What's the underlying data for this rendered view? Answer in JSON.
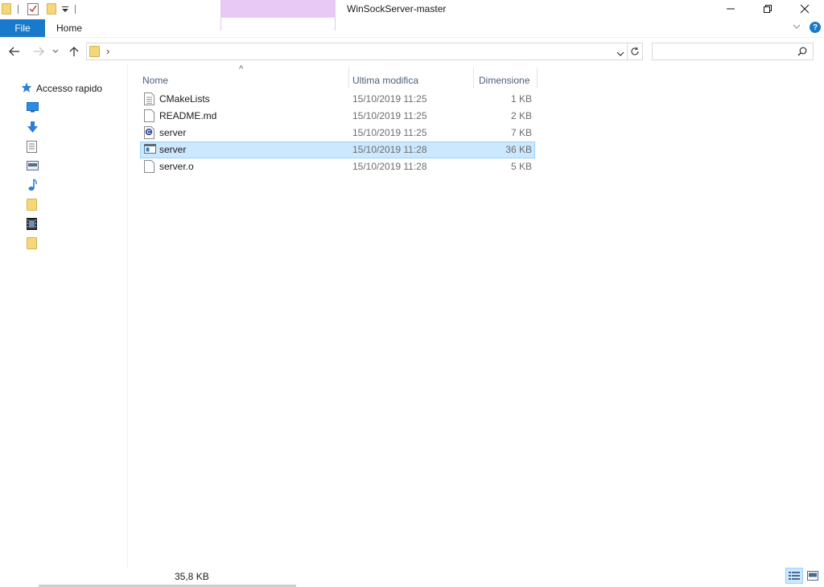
{
  "window": {
    "title": "WinSockServer-master"
  },
  "ribbon": {
    "tabs": [
      {
        "label": "File",
        "active": true
      },
      {
        "label": "Home",
        "active": false
      }
    ]
  },
  "address": {
    "path_separator": "›",
    "search_placeholder": ""
  },
  "navpane": {
    "quick_access_label": "Accesso rapido",
    "items": [
      {
        "icon": "desktop-icon"
      },
      {
        "icon": "downloads-icon"
      },
      {
        "icon": "documents-icon"
      },
      {
        "icon": "pictures-icon"
      },
      {
        "icon": "music-icon"
      },
      {
        "icon": "folder-icon"
      },
      {
        "icon": "videos-icon"
      },
      {
        "icon": "folder-icon"
      }
    ]
  },
  "filelist": {
    "columns": {
      "name": "Nome",
      "modified": "Ultima modifica",
      "size": "Dimensione"
    },
    "sort_indicator": "^",
    "files": [
      {
        "name": "CMakeLists",
        "modified": "15/10/2019 11:25",
        "size": "1 KB",
        "icon": "text-file-icon",
        "selected": false
      },
      {
        "name": "README.md",
        "modified": "15/10/2019 11:25",
        "size": "2 KB",
        "icon": "blank-file-icon",
        "selected": false
      },
      {
        "name": "server",
        "modified": "15/10/2019 11:25",
        "size": "7 KB",
        "icon": "c-source-file-icon",
        "selected": false
      },
      {
        "name": "server",
        "modified": "15/10/2019 11:28",
        "size": "36 KB",
        "icon": "executable-file-icon",
        "selected": true
      },
      {
        "name": "server.o",
        "modified": "15/10/2019 11:28",
        "size": "5 KB",
        "icon": "blank-file-icon",
        "selected": false
      }
    ]
  },
  "statusbar": {
    "selection_size": "35,8 KB"
  },
  "colors": {
    "accent": "#1979ca",
    "selection_bg": "#cce8ff",
    "selection_border": "#99d1ff",
    "contextual_tab": "#e8c8f4",
    "help": "#1979ca"
  }
}
